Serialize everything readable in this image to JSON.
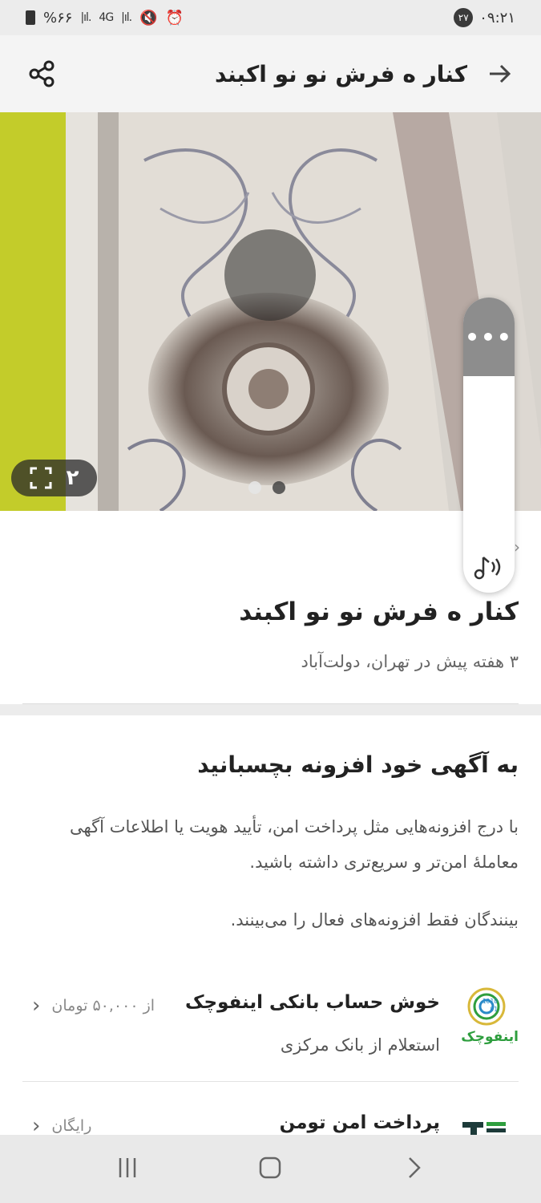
{
  "status_bar": {
    "time": "۰۹:۲۱",
    "notification_count": "۲۷",
    "battery": "%۶۶",
    "network": "4G"
  },
  "app_bar": {
    "title": "کنار ه فرش نو نو اکبند"
  },
  "gallery": {
    "image_count": "۲",
    "dots": 2,
    "active_dot": 0
  },
  "side_panel": {
    "menu_label": "•••"
  },
  "ad": {
    "title": "کنار ه فرش نو نو اکبند",
    "meta": "۳ هفته پیش در تهران، دولت‌آباد"
  },
  "addons": {
    "title": "به آگهی خود افزونه بچسبانید",
    "description": "با درج افزونه‌هایی مثل پرداخت امن، تأیید هویت یا اطلاعات آگهی معاملهٔ امن‌تر و سریع‌تری داشته باشید.",
    "note": "بینندگان فقط افزونه‌های فعال را می‌بینند.",
    "items": [
      {
        "title": "خوش حساب بانکی اینفوچک",
        "subtitle": "استعلام از بانک مرکزی",
        "price": "از ۵۰,۰۰۰ تومان",
        "logo_text": "اینفوچک"
      },
      {
        "title": "پرداخت امن تومن",
        "subtitle": "",
        "price": "رایگان",
        "logo_text": ""
      }
    ]
  },
  "colors": {
    "accent": "#2e9e3e",
    "logo_dark": "#1d3b3a"
  }
}
